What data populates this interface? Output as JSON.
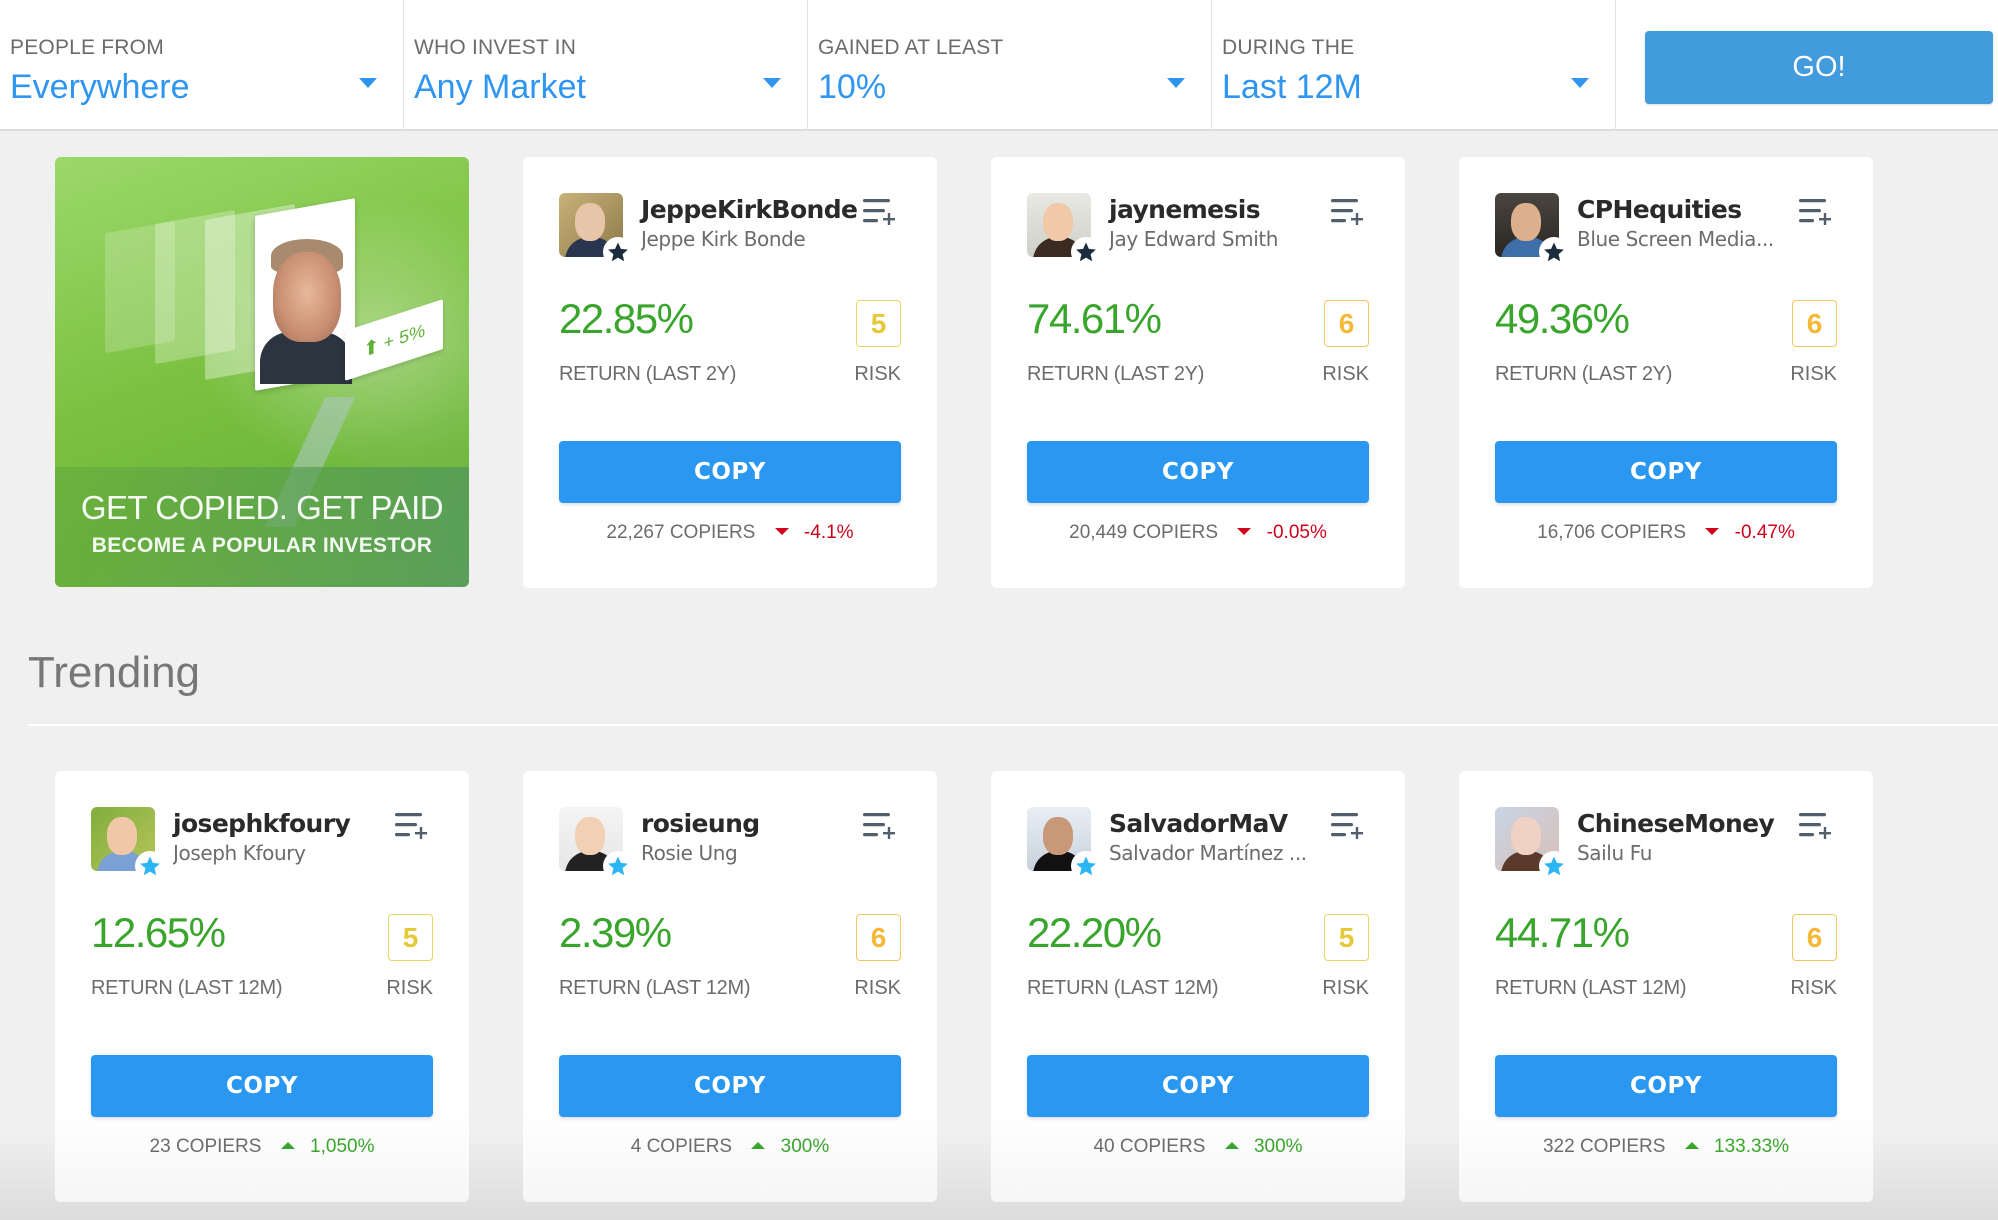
{
  "filters": [
    {
      "label": "PEOPLE FROM",
      "value": "Everywhere"
    },
    {
      "label": "WHO INVEST IN",
      "value": "Any Market"
    },
    {
      "label": "GAINED AT LEAST",
      "value": "10%"
    },
    {
      "label": "DURING THE",
      "value": "Last 12M"
    }
  ],
  "go_button": "GO!",
  "banner": {
    "headline": "GET COPIED. GET PAID",
    "subline": "BECOME A POPULAR INVESTOR",
    "gain_tag": "+ 5%"
  },
  "labels": {
    "risk": "RISK",
    "copy": "COPY",
    "copiers_suffix": "COPIERS"
  },
  "colors": {
    "accent_blue": "#2a98f0",
    "positive_green": "#3aa52c",
    "negative_red": "#d0021b",
    "risk5_yellow": "#e5c93a",
    "risk6_orange": "#f5b839"
  },
  "popular": [
    {
      "username": "JeppeKirkBonde",
      "fullname": "Jeppe Kirk Bonde",
      "badge": "popular-investor-star-dark",
      "return": "22.85%",
      "return_label": "RETURN (LAST 2Y)",
      "risk": "5",
      "copiers": "22,267",
      "change": "-4.1%",
      "trend": "down"
    },
    {
      "username": "jaynemesis",
      "fullname": "Jay Edward Smith",
      "badge": "popular-investor-star-dark",
      "return": "74.61%",
      "return_label": "RETURN (LAST 2Y)",
      "risk": "6",
      "copiers": "20,449",
      "change": "-0.05%",
      "trend": "down"
    },
    {
      "username": "CPHequities",
      "fullname": "Blue Screen Media...",
      "badge": "popular-investor-star-dark",
      "return": "49.36%",
      "return_label": "RETURN (LAST 2Y)",
      "risk": "6",
      "copiers": "16,706",
      "change": "-0.47%",
      "trend": "down"
    }
  ],
  "trending": {
    "title": "Trending",
    "items": [
      {
        "username": "josephkfoury",
        "fullname": "Joseph Kfoury",
        "badge": "popular-investor-star-blue",
        "return": "12.65%",
        "return_label": "RETURN (LAST 12M)",
        "risk": "5",
        "copiers": "23",
        "change": "1,050%",
        "trend": "up"
      },
      {
        "username": "rosieung",
        "fullname": "Rosie Ung",
        "badge": "popular-investor-star-blue",
        "return": "2.39%",
        "return_label": "RETURN (LAST 12M)",
        "risk": "6",
        "copiers": "4",
        "change": "300%",
        "trend": "up"
      },
      {
        "username": "SalvadorMaV",
        "fullname": "Salvador Martínez ...",
        "badge": "popular-investor-star-blue",
        "return": "22.20%",
        "return_label": "RETURN (LAST 12M)",
        "risk": "5",
        "copiers": "40",
        "change": "300%",
        "trend": "up"
      },
      {
        "username": "ChineseMoney",
        "fullname": "Sailu Fu",
        "badge": "popular-investor-star-blue",
        "return": "44.71%",
        "return_label": "RETURN (LAST 12M)",
        "risk": "6",
        "copiers": "322",
        "change": "133.33%",
        "trend": "up"
      }
    ]
  }
}
